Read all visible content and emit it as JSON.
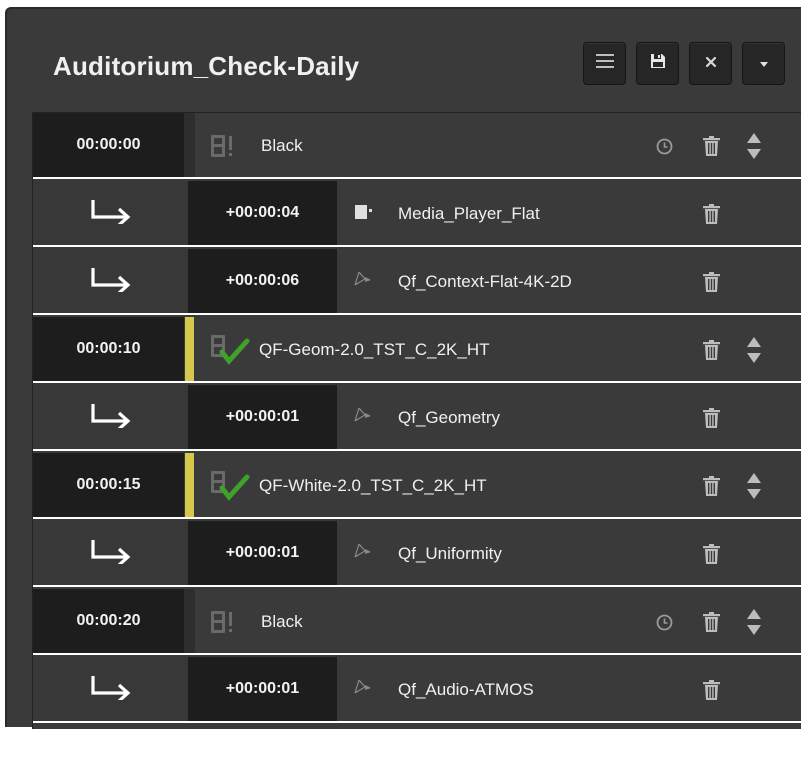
{
  "header": {
    "title": "Auditorium_Check-Daily",
    "buttons": [
      {
        "name": "menu-button",
        "icon": "hamburger-icon"
      },
      {
        "name": "save-button",
        "icon": "floppy-disk-icon"
      },
      {
        "name": "close-button",
        "icon": "close-icon"
      },
      {
        "name": "dropdown-button",
        "icon": "caret-down-icon"
      }
    ]
  },
  "items": [
    {
      "type": "main",
      "time": "00:00:00",
      "label": "Black",
      "icon": "film-warning-icon",
      "marked": false,
      "clock": true,
      "reorder": true
    },
    {
      "type": "sub",
      "offset": "+00:00:04",
      "label": "Media_Player_Flat",
      "icon": "media-player-icon"
    },
    {
      "type": "sub",
      "offset": "+00:00:06",
      "label": "Qf_Context-Flat-4K-2D",
      "icon": "cue-icon"
    },
    {
      "type": "main",
      "time": "00:00:10",
      "label": "QF-Geom-2.0_TST_C_2K_HT",
      "icon": "film-check-icon",
      "marked": true,
      "clock": false,
      "reorder": true
    },
    {
      "type": "sub",
      "offset": "+00:00:01",
      "label": "Qf_Geometry",
      "icon": "cue-icon"
    },
    {
      "type": "main",
      "time": "00:00:15",
      "label": "QF-White-2.0_TST_C_2K_HT",
      "icon": "film-check-icon",
      "marked": true,
      "clock": false,
      "reorder": true
    },
    {
      "type": "sub",
      "offset": "+00:00:01",
      "label": "Qf_Uniformity",
      "icon": "cue-icon"
    },
    {
      "type": "main",
      "time": "00:00:20",
      "label": "Black",
      "icon": "film-warning-icon",
      "marked": false,
      "clock": true,
      "reorder": true
    },
    {
      "type": "sub",
      "offset": "+00:00:01",
      "label": "Qf_Audio-ATMOS",
      "icon": "cue-icon"
    }
  ],
  "colors": {
    "panel": "#3a3a3a",
    "time_cell": "#1d1d1d",
    "marker": "#d6c84c",
    "check": "#3fa02b",
    "text": "#f0f0f0"
  }
}
